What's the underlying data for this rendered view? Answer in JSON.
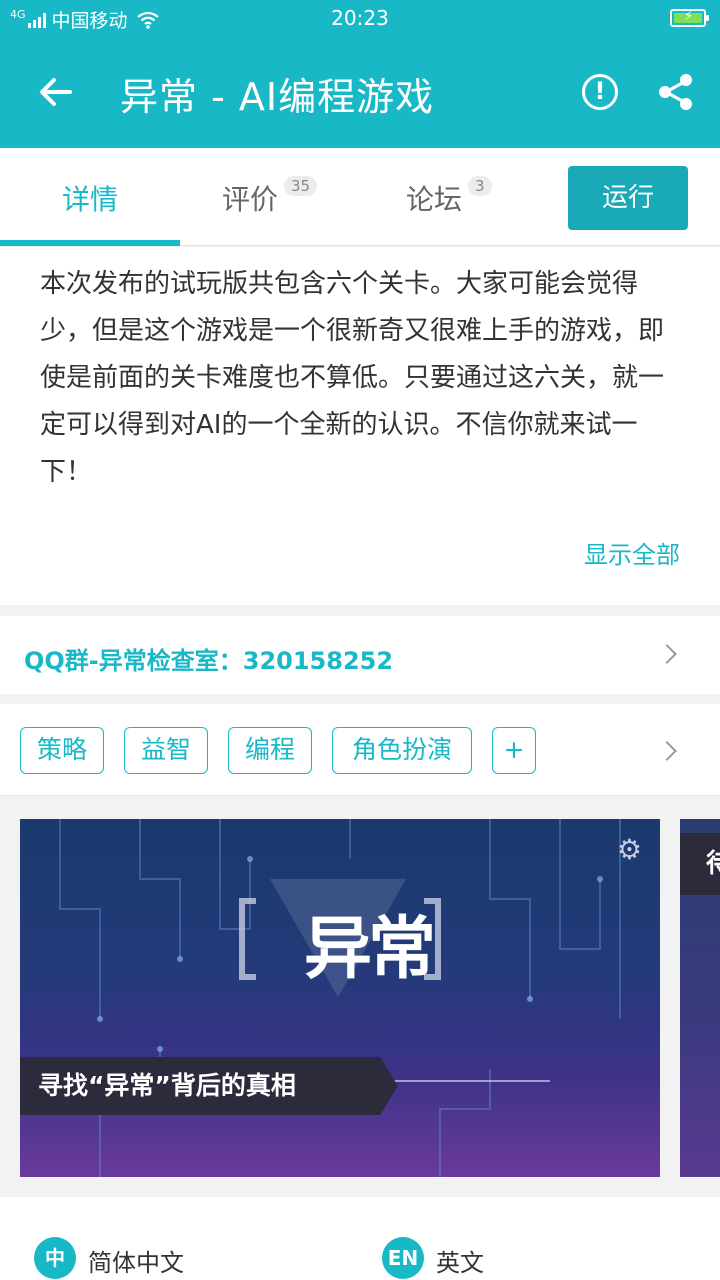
{
  "status_bar": {
    "signal": "4G",
    "carrier": "中国移动",
    "time": "20:23"
  },
  "header": {
    "title": "异常 - AI编程游戏",
    "back_icon": "arrow-left-icon",
    "report_icon": "alert-circle-icon",
    "share_icon": "share-icon"
  },
  "tabs": [
    {
      "label": "详情",
      "active": true
    },
    {
      "label": "评价",
      "count": "35"
    },
    {
      "label": "论坛",
      "count": "3"
    }
  ],
  "run_label": "运行",
  "description": {
    "text": "本次发布的试玩版共包含六个关卡。大家可能会觉得少，但是这个游戏是一个很新奇又很难上手的游戏，即使是前面的关卡难度也不算低。只要通过这六关，就一定可以得到对AI的一个全新的认识。不信你就来试一下！",
    "show_all": "显示全部"
  },
  "qq_group": "QQ群-异常检查室：320158252",
  "tags": [
    "策略",
    "益智",
    "编程",
    "角色扮演",
    "+"
  ],
  "screenshots": {
    "logo": "异常",
    "banner": "寻找“异常”背后的真相",
    "second_banner_char": "待"
  },
  "languages": [
    {
      "icon": "中",
      "label": "简体中文"
    },
    {
      "icon": "EN",
      "label": "英文"
    }
  ],
  "colors": {
    "accent": "#19b8c7",
    "run_button": "#1aa9b7"
  }
}
